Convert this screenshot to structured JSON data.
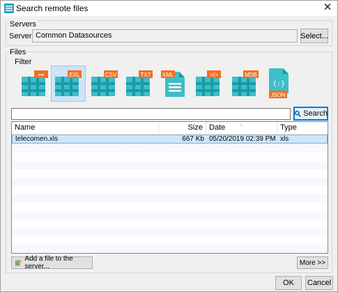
{
  "window": {
    "title": "Search remote files",
    "close_glyph": "✕"
  },
  "servers": {
    "legend": "Servers",
    "label": "Server:",
    "value": "Common Datasources",
    "select_button": "Select..."
  },
  "files": {
    "legend": "Files",
    "filter_legend": "Filter",
    "filters": [
      {
        "name": "generic",
        "badge": "•••",
        "badge_color": "#f26f21",
        "icon": "grid-icon",
        "selected": false
      },
      {
        "name": "excel",
        "badge": "EXL",
        "badge_color": "#f26f21",
        "icon": "grid-icon",
        "selected": true
      },
      {
        "name": "csv",
        "badge": "CSV",
        "badge_color": "#f26f21",
        "icon": "grid-icon",
        "selected": false
      },
      {
        "name": "txt",
        "badge": "TXT",
        "badge_color": "#f26f21",
        "icon": "grid-icon",
        "selected": false
      },
      {
        "name": "xml",
        "badge": "XML",
        "badge_color": "#f26f21",
        "icon": "document-icon",
        "selected": false
      },
      {
        "name": "html",
        "badge": "</>",
        "badge_color": "#f26f21",
        "icon": "grid-icon",
        "selected": false
      },
      {
        "name": "mdb",
        "badge": "MDB",
        "badge_color": "#f26f21",
        "icon": "grid-icon",
        "selected": false
      },
      {
        "name": "json",
        "badge": "JSON",
        "badge_color": "#f26f21",
        "icon": "json-document-icon",
        "selected": false
      }
    ],
    "search_value": "",
    "search_button": "Search"
  },
  "table": {
    "columns": [
      "Name",
      "Size",
      "Date",
      "Type"
    ],
    "rows": [
      {
        "name": "telecomen.xls",
        "size": "667 Kb",
        "date": "05/20/2019 02:39 PM",
        "type": "xls"
      }
    ]
  },
  "buttons": {
    "add_file": "Add a file to the server...",
    "more": "More >>",
    "ok": "OK",
    "cancel": "Cancel"
  },
  "colors": {
    "accent": "#0078d7",
    "grid_teal": "#3dbec9",
    "grid_teal_dark": "#1a9aa6",
    "badge_orange": "#f26f21",
    "selection_bg": "#cce8ff"
  }
}
